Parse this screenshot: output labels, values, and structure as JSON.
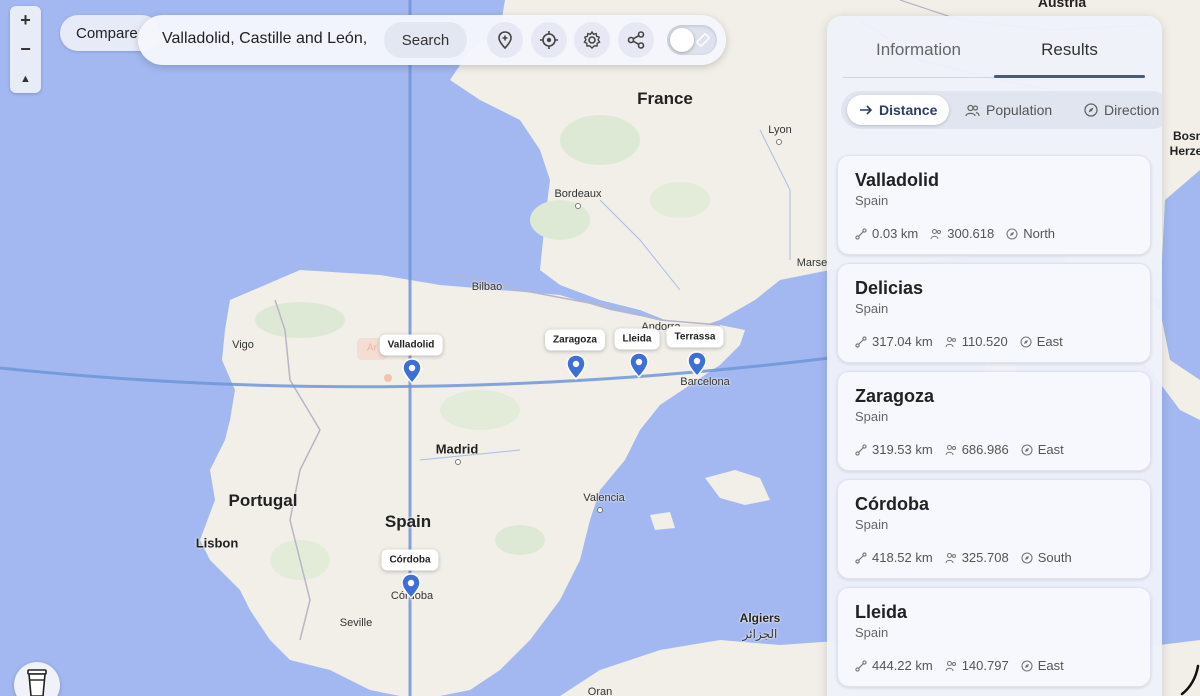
{
  "map": {
    "countries": [
      "France",
      "Spain",
      "Portugal",
      "Austria",
      "Andorra",
      "Bosnia and Herzegovina"
    ],
    "country_labels": {
      "france": "France",
      "spain": "Spain",
      "portugal": "Portugal",
      "austria": "Austria",
      "andorra": "Andorra",
      "bosnia": "Bosn",
      "herze": "Herze"
    },
    "city_labels": {
      "madrid": "Madrid",
      "lisbon": "Lisbon",
      "bordeaux": "Bordeaux",
      "lyon": "Lyon",
      "bilbao": "Bilbao",
      "vigo": "Vigo",
      "barcelona": "Barcelona",
      "valencia": "Valencia",
      "seville": "Seville",
      "cordoba_city": "Córdoba",
      "algiers": "Algiers",
      "algiers_ar": "الجزائر",
      "marseille": "Marse",
      "oran": "Oran",
      "ar": "Ar"
    },
    "markers": [
      "Valladolid",
      "Zaragoza",
      "Lleida",
      "Terrassa",
      "Córdoba"
    ],
    "marker_color": "#3d6fd6",
    "line_color": "#6f95d8"
  },
  "controls": {
    "zoom_in": "+",
    "zoom_out": "−",
    "north": "▲",
    "compare_label": "Compare",
    "search_value": "Valladolid, Castille and León,",
    "search_button": "Search"
  },
  "panel": {
    "tabs": [
      "Information",
      "Results"
    ],
    "active_tab": "Results",
    "sort_options": [
      "Distance",
      "Population",
      "Direction"
    ],
    "active_sort": "Distance",
    "results": [
      {
        "name": "Valladolid",
        "country": "Spain",
        "distance": "0.03 km",
        "population": "300.618",
        "direction": "North"
      },
      {
        "name": "Delicias",
        "country": "Spain",
        "distance": "317.04 km",
        "population": "110.520",
        "direction": "East"
      },
      {
        "name": "Zaragoza",
        "country": "Spain",
        "distance": "319.53 km",
        "population": "686.986",
        "direction": "East"
      },
      {
        "name": "Córdoba",
        "country": "Spain",
        "distance": "418.52 km",
        "population": "325.708",
        "direction": "South"
      },
      {
        "name": "Lleida",
        "country": "Spain",
        "distance": "444.22 km",
        "population": "140.797",
        "direction": "East"
      }
    ]
  }
}
